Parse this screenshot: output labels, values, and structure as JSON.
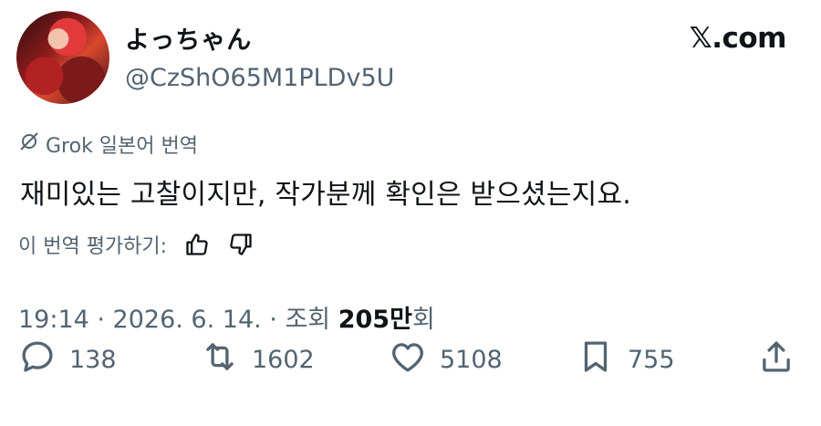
{
  "author": {
    "display_name": "よっちゃん",
    "handle": "@CzShO65M1PLDv5U"
  },
  "brand": {
    "logo_letter": "𝕏",
    "domain": ".com"
  },
  "translation": {
    "label": "Grok 일본어 번역",
    "icon": "grok-slash-icon"
  },
  "tweet": {
    "text": "재미있는 고찰이지만, 작가분께 확인은 받으셨는지요."
  },
  "rating": {
    "label": "이 번역 평가하기:",
    "thumbs_up_icon": "thumbs-up-icon",
    "thumbs_down_icon": "thumbs-down-icon"
  },
  "meta": {
    "prefix": "19:14 · 2026. 6. 14. · 조회 ",
    "views_number": "205",
    "views_unit": "만",
    "views_suffix": "회"
  },
  "actions": {
    "replies": "138",
    "reposts": "1602",
    "likes": "5108",
    "bookmarks": "755"
  },
  "colors": {
    "text_primary": "#0f1419",
    "text_secondary": "#536471",
    "background": "#ffffff"
  }
}
